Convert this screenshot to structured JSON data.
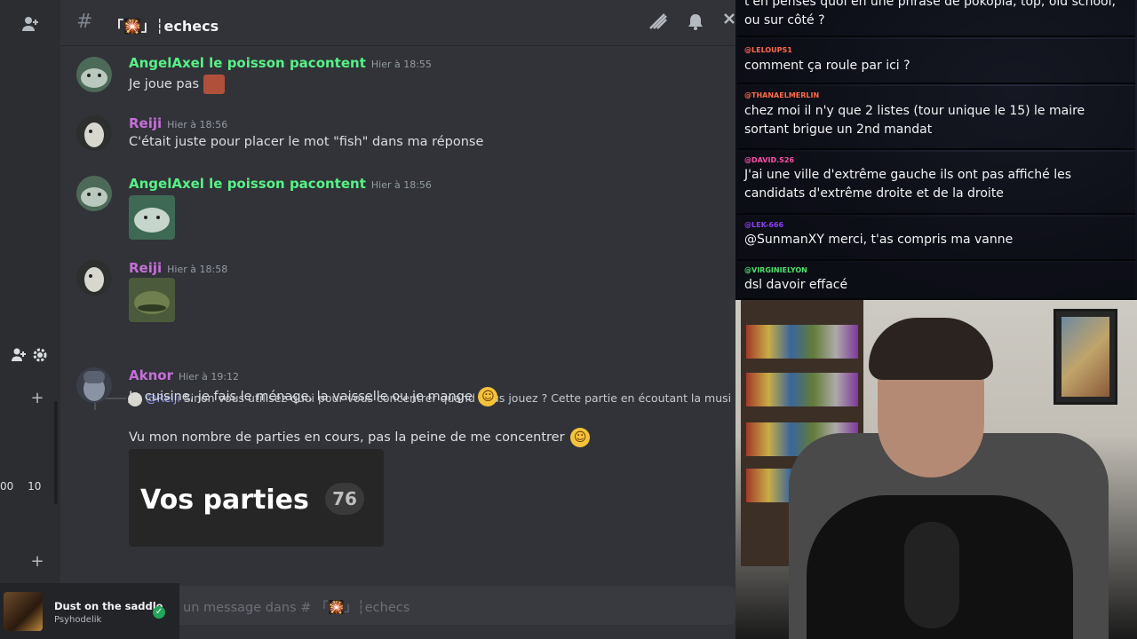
{
  "sidebar": {
    "counts": [
      "00",
      "10"
    ]
  },
  "header": {
    "channel_name": "「🎇」┆echecs"
  },
  "messages": [
    {
      "username": "AngelAxel le poisson pacontent",
      "time": "Hier à 18:55",
      "text": "Je joue pas",
      "color": "#57f287"
    },
    {
      "username": "Reiji",
      "time": "Hier à 18:56",
      "text": "C'était juste pour placer le mot \"fish\" dans ma réponse",
      "color": "#c86edc"
    },
    {
      "username": "AngelAxel le poisson pacontent",
      "time": "Hier à 18:56",
      "color": "#57f287"
    },
    {
      "username": "Reiji",
      "time": "Hier à 18:58",
      "color": "#c86edc"
    },
    {
      "reply_mention": "@Reiji",
      "reply_text": "Sinon vous utilisez quoi pour vous concentrer quand vous jouez ? Cette partie en écoutant la musi",
      "username": "Aknor",
      "time": "Hier à 19:12",
      "color": "#c86edc",
      "line1": "Je cuisine, je fais le ménage, la vaisselle ou je mange",
      "line2": "Vu mon nombre de parties en cours, pas la peine de me concentrer",
      "card_label": "Vos parties",
      "card_count": "76"
    }
  ],
  "composer": {
    "placeholder": "un message dans # 「🎇」┆echecs"
  },
  "now_playing": {
    "title": "Dust on the saddle",
    "artist": "Psyhodelik"
  },
  "chat": [
    {
      "user": "",
      "text": "t'en penses quoi en une phrase de pokopia, top, old school, ou sur côté ?",
      "color": "#ffffff"
    },
    {
      "user": "@LELOUPS1",
      "text": "comment ça roule par ici ?",
      "color": "#ff6b4a"
    },
    {
      "user": "@THANAELMERLIN",
      "text": "chez moi il n'y que 2 listes (tour unique le 15) le maire sortant brigue un 2nd mandat",
      "color": "#ff6b4a"
    },
    {
      "user": "@DAVID.S26",
      "text": "J'ai une ville d'extrême gauche ils ont pas affiché les candidats d'extrême droite et de la droite",
      "color": "#ff4fa8"
    },
    {
      "user": "@LEK-666",
      "text": "@SunmanXY merci, t'as compris ma vanne",
      "color": "#8a3ff0"
    },
    {
      "user": "@VIRGINIELYON",
      "text": "dsl davoir effacé",
      "color": "#4fe06a"
    }
  ]
}
